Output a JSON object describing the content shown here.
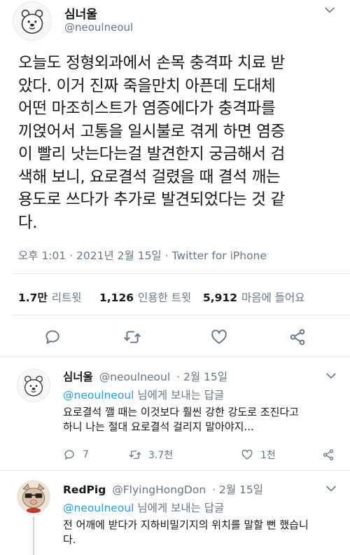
{
  "main": {
    "display_name": "심너울",
    "handle": "@neoulneoul",
    "text": "오늘도 정형외과에서 손목 충격파 치료 받\n았다. 이거 진짜 죽을만치 아픈데 도대체\n어떤 마조히스트가 염증에다가 충격파를\n끼얹어서 고통을 일시불로 겪게 하면 염증\n이 빨리 낫는다는걸 발견한지 궁금해서 검\n색해 보니, 요로결석 걸렸을 때 결석 깨는\n용도로 쓰다가 추가로 발견되었다는 것 같\n다.",
    "timestamp": "오후 1:01 · 2021년 2월 15일 · ",
    "source": "Twitter for iPhone",
    "stats": {
      "retweets_count": "1.7만",
      "retweets_label": "리트윗",
      "quotes_count": "1,126",
      "quotes_label": "인용한 트윗",
      "likes_count": "5,912",
      "likes_label": "마음에 들어요"
    }
  },
  "icons": {
    "more": "chevron-down-icon",
    "reply": "reply-icon",
    "retweet": "retweet-icon",
    "like": "heart-icon",
    "share": "share-icon"
  },
  "replies": [
    {
      "display_name": "심너울",
      "handle": "@neoulneoul",
      "date": "· 2월 15일",
      "mention": "@neoulneoul",
      "reply_to_suffix": " 님에게 보내는 답글",
      "text": "요로결석 깰 때는 이것보다 훨씬 강한 강도로 조진다고\n하니 나는 절대 요로결석 걸리지 말아야지...",
      "reply_count": "7",
      "retweet_count": "3.7천",
      "like_count": "1천"
    },
    {
      "display_name": "RedPig",
      "handle": "@FlyingHongDon",
      "date": "· 2월 15일",
      "mention": "@neoulneoul",
      "reply_to_suffix": " 님에게 보내는 답글",
      "text": "전 어깨에 받다가 지하비밀기지의 위치를 말할 뻔 했습니\n다."
    }
  ],
  "colors": {
    "accent": "#1da1f2",
    "secondary_text": "#657786",
    "divider": "#e1e8ed"
  }
}
